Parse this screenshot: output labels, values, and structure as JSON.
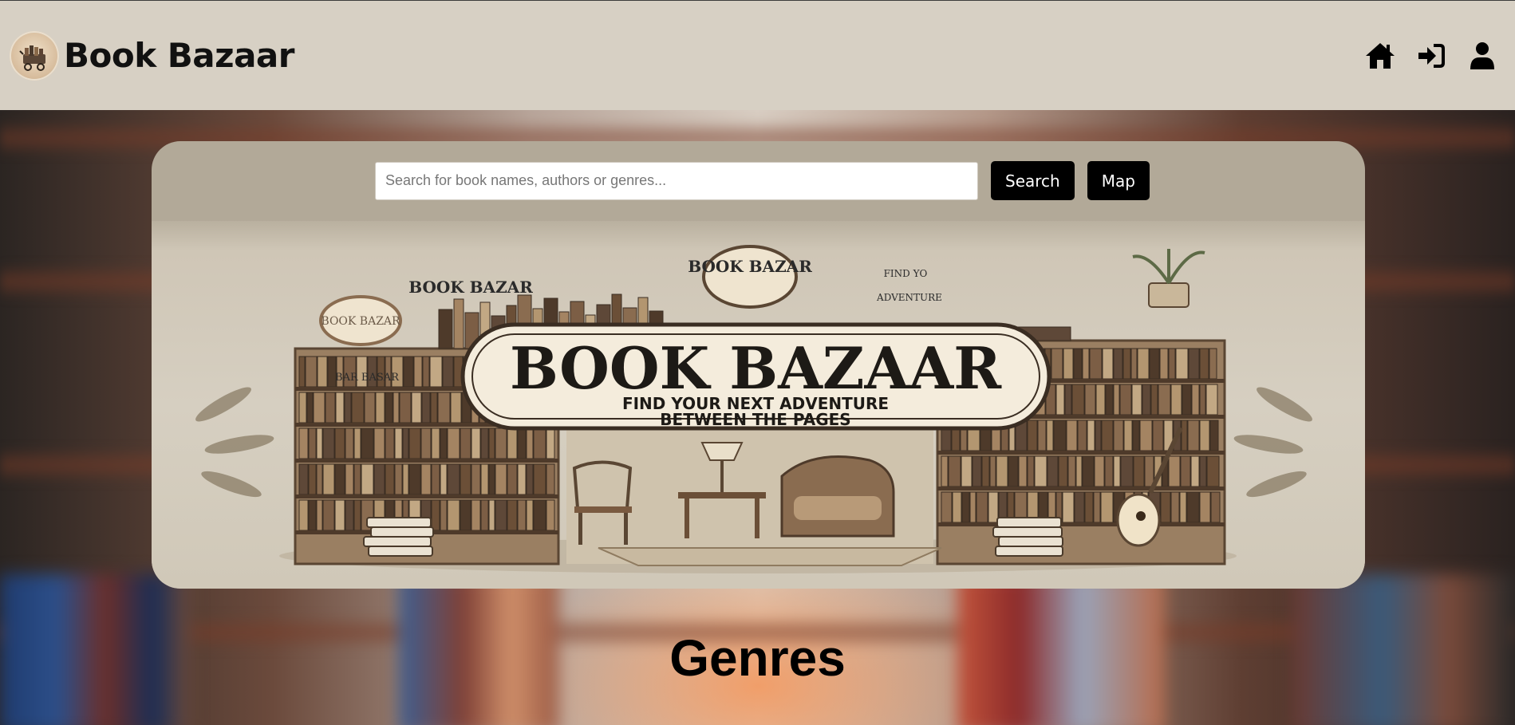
{
  "header": {
    "brand_name": "Book Bazaar",
    "nav": [
      {
        "name": "home",
        "icon": "home-icon"
      },
      {
        "name": "login",
        "icon": "sign-in-icon"
      },
      {
        "name": "profile",
        "icon": "user-icon"
      }
    ]
  },
  "search": {
    "placeholder": "Search for book names, authors or genres...",
    "value": "",
    "search_label": "Search",
    "map_label": "Map"
  },
  "banner": {
    "title": "BOOK BAZAAR",
    "tagline_line1": "FIND YOUR NEXT ADVENTURE",
    "tagline_line2": "BETWEEN THE PAGES",
    "sign_top": "BOOK BAZAR",
    "sign_left": "BOOK BAZAR",
    "sign_oval": "BOOK BAZAR",
    "sign_small": "BAR BASAR",
    "sign_stack_line1": "FIND YO",
    "sign_stack_line2": "ADVENTURE"
  },
  "section": {
    "heading": "Genres"
  },
  "colors": {
    "header_bg": "#d7d0c4",
    "hero_bg": "#b2a998",
    "button_bg": "#000000",
    "button_text": "#ffffff"
  }
}
